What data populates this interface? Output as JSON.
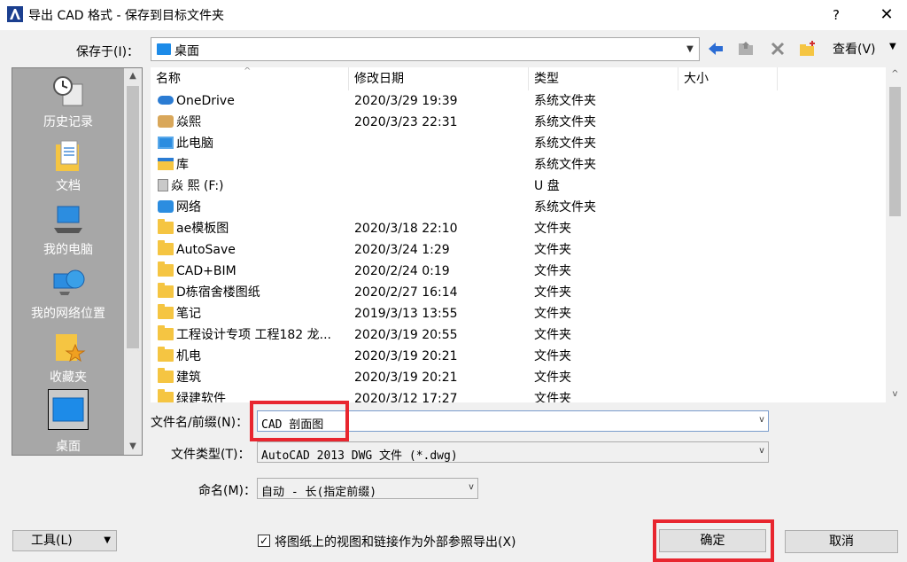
{
  "window": {
    "title": "导出 CAD 格式 - 保存到目标文件夹",
    "help": "?",
    "close": "✕"
  },
  "toolbar": {
    "save_in_label": "保存于(I)：",
    "save_in_value": "桌面",
    "back_icon": "back-arrow-icon",
    "view_label": "查看(V)"
  },
  "places": [
    {
      "label": "历史记录",
      "icon": "history-icon"
    },
    {
      "label": "文档",
      "icon": "documents-icon"
    },
    {
      "label": "我的电脑",
      "icon": "computer-icon"
    },
    {
      "label": "我的网络位置",
      "icon": "network-icon"
    },
    {
      "label": "收藏夹",
      "icon": "favorites-icon"
    },
    {
      "label": "桌面",
      "icon": "desktop-icon"
    }
  ],
  "columns": {
    "name": "名称",
    "date": "修改日期",
    "type": "类型",
    "size": "大小"
  },
  "files": [
    {
      "name": "OneDrive",
      "date": "2020/3/29 19:39",
      "type": "系统文件夹",
      "icon": "cloud"
    },
    {
      "name": "焱熙",
      "date": "2020/3/23 22:31",
      "type": "系统文件夹",
      "icon": "user"
    },
    {
      "name": "此电脑",
      "date": "",
      "type": "系统文件夹",
      "icon": "pc"
    },
    {
      "name": "库",
      "date": "",
      "type": "系统文件夹",
      "icon": "lib"
    },
    {
      "name": "焱 熙 (F:)",
      "date": "",
      "type": "U 盘",
      "icon": "usb"
    },
    {
      "name": "网络",
      "date": "",
      "type": "系统文件夹",
      "icon": "net"
    },
    {
      "name": "ae模板图",
      "date": "2020/3/18 22:10",
      "type": "文件夹",
      "icon": "folder"
    },
    {
      "name": "AutoSave",
      "date": "2020/3/24 1:29",
      "type": "文件夹",
      "icon": "folder"
    },
    {
      "name": "CAD+BIM",
      "date": "2020/2/24 0:19",
      "type": "文件夹",
      "icon": "folder"
    },
    {
      "name": "D栋宿舍楼图纸",
      "date": "2020/2/27 16:14",
      "type": "文件夹",
      "icon": "folder"
    },
    {
      "name": "笔记",
      "date": "2019/3/13 13:55",
      "type": "文件夹",
      "icon": "folder"
    },
    {
      "name": "工程设计专项 工程182 龙...",
      "date": "2020/3/19 20:55",
      "type": "文件夹",
      "icon": "folder"
    },
    {
      "name": "机电",
      "date": "2020/3/19 20:21",
      "type": "文件夹",
      "icon": "folder"
    },
    {
      "name": "建筑",
      "date": "2020/3/19 20:21",
      "type": "文件夹",
      "icon": "folder"
    },
    {
      "name": "绿建软件",
      "date": "2020/3/12 17:27",
      "type": "文件夹",
      "icon": "folder"
    }
  ],
  "form": {
    "filename_label": "文件名/前缀(N)：",
    "filename_value": "CAD 剖面图",
    "filetype_label": "文件类型(T)：",
    "filetype_value": "AutoCAD 2013 DWG 文件  (*.dwg)",
    "naming_label": "命名(M)：",
    "naming_value": "自动 - 长(指定前缀)"
  },
  "footer": {
    "tools_label": "工具(L)",
    "checkbox_label": "将图纸上的视图和链接作为外部参照导出(X)",
    "checkbox_checked": true,
    "ok_label": "确定",
    "cancel_label": "取消"
  },
  "colors": {
    "highlight": "#e8262f",
    "accent": "#2c8de0"
  }
}
